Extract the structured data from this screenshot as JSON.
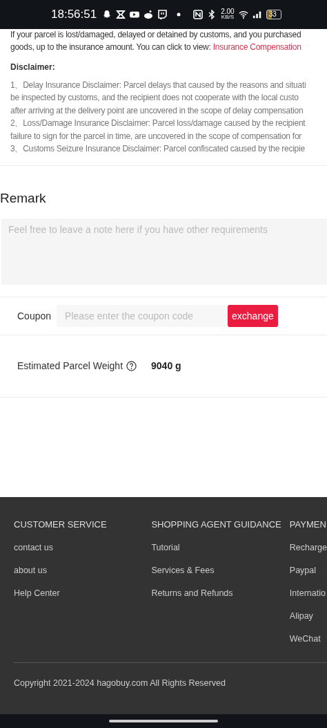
{
  "status_bar": {
    "time": "18:56:51",
    "speed_value": "2.00",
    "speed_unit": "KB/S",
    "battery": "33"
  },
  "insurance": {
    "cut_line": "If your parcel is lost/damaged, delayed or detained by customs, and you purchased",
    "line": "goods, up to the insurance amount. You can click to view: ",
    "link": "Insurance Compensation"
  },
  "disclaimer": {
    "title": "Disclaimer:",
    "lines": [
      "1、Delay Insurance Disclaimer: Parcel delays that caused by the reasons and situati",
      "be inspected by customs, and the recipient does not cooperate with the local custo",
      "after arriving at the delivery point are uncovered in the scope of delay compensation",
      "2、Loss/Damage Insurance Disclaimer: Parcel loss/damage caused by the recipient",
      "failure to sign for the parcel in time, are uncovered in the scope of compensation for",
      "3、Customs Seizure Insurance Disclaimer: Parcel confiscated caused by the recipie"
    ]
  },
  "remark": {
    "title": "Remark",
    "placeholder": "Feel free to leave a note here if you have other requirements"
  },
  "coupon": {
    "label": "Coupon",
    "placeholder": "Please enter the coupon code",
    "button": "exchange"
  },
  "weight": {
    "label": "Estimated Parcel Weight",
    "value": "9040 g"
  },
  "footer": {
    "columns": [
      {
        "title": "CUSTOMER SERVICE",
        "links": [
          "contact us",
          "about us",
          "Help Center"
        ]
      },
      {
        "title": "SHOPPING AGENT GUIDANCE",
        "links": [
          "Tutorial",
          "Services & Fees",
          "Returns and Refunds"
        ]
      },
      {
        "title": "PAYMEN",
        "links": [
          "Recharge",
          "Paypal",
          "Internatio",
          "Alipay",
          "WeChat"
        ]
      }
    ],
    "copyright": "Copyright 2021-2024 hagobuy.com All Rights Reserved"
  }
}
